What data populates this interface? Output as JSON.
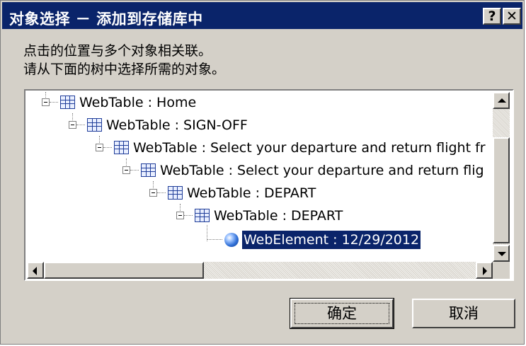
{
  "dialog": {
    "title": "对象选择 － 添加到存储库中",
    "help_label": "?",
    "close_label": "✕"
  },
  "prompt": {
    "line1": "点击的位置与多个对象相关联。",
    "line2": "请从下面的树中选择所需的对象。"
  },
  "tree": {
    "nodes": [
      {
        "label": "WebTable : Home",
        "icon": "table-icon",
        "level": 0
      },
      {
        "label": "WebTable : SIGN-OFF",
        "icon": "table-icon",
        "level": 1
      },
      {
        "label": "WebTable : Select your departure and return flight fr",
        "icon": "table-icon",
        "level": 2
      },
      {
        "label": "WebTable : Select your departure and return flig",
        "icon": "table-icon",
        "level": 3
      },
      {
        "label": "WebTable : DEPART",
        "icon": "table-icon",
        "level": 4
      },
      {
        "label": "WebTable : DEPART",
        "icon": "table-icon",
        "level": 5
      },
      {
        "label": "WebElement : 12/29/2012",
        "icon": "globe-icon",
        "level": 6,
        "selected": true
      }
    ]
  },
  "buttons": {
    "ok_label": "确定",
    "cancel_label": "取消"
  },
  "colors": {
    "titlebar": "#0a246a",
    "dialog_face": "#d4d0c8",
    "selection": "#0a246a"
  }
}
